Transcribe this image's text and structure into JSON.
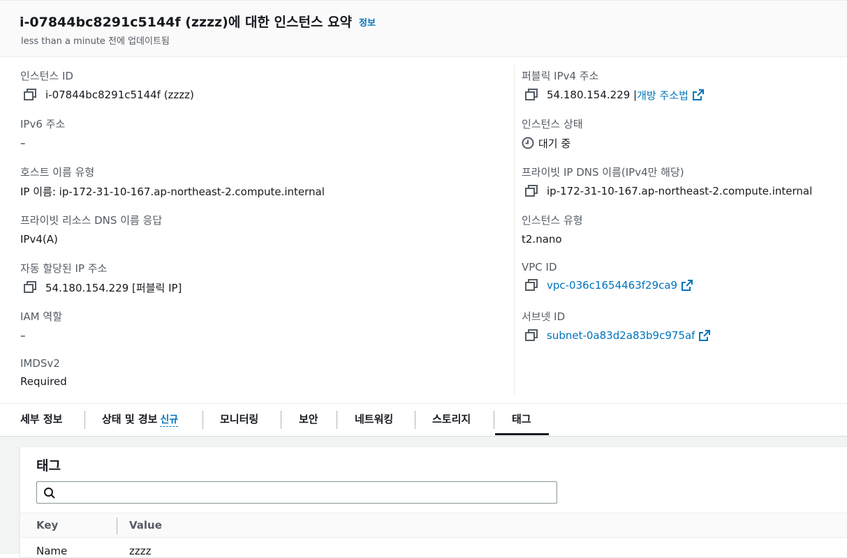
{
  "header": {
    "title": "i-07844bc8291c5144f (zzzz)에 대한 인스턴스 요약",
    "info_link": "정보",
    "updated": "less than a minute 전에 업데이트됨"
  },
  "left": {
    "instance_id": {
      "label": "인스턴스 ID",
      "value": "i-07844bc8291c5144f (zzzz)"
    },
    "ipv6": {
      "label": "IPv6 주소",
      "value": "–"
    },
    "hostname_type": {
      "label": "호스트 이름 유형",
      "value": "IP 이름: ip-172-31-10-167.ap-northeast-2.compute.internal"
    },
    "private_dns_answer": {
      "label": "프라이빗 리소스 DNS 이름 응답",
      "value": "IPv4(A)"
    },
    "auto_ip": {
      "label": "자동 할당된 IP 주소",
      "value": "54.180.154.229 [퍼블릭 IP]"
    },
    "iam_role": {
      "label": "IAM 역할",
      "value": "–"
    },
    "imdsv2": {
      "label": "IMDSv2",
      "value": "Required"
    }
  },
  "right": {
    "public_ipv4": {
      "label": "퍼블릭 IPv4 주소",
      "value": "54.180.154.229 |",
      "link": "개방 주소법"
    },
    "state": {
      "label": "인스턴스 상태",
      "value": "대기 중"
    },
    "private_dns": {
      "label": "프라이빗 IP DNS 이름(IPv4만 해당)",
      "value": "ip-172-31-10-167.ap-northeast-2.compute.internal"
    },
    "instance_type": {
      "label": "인스턴스 유형",
      "value": "t2.nano"
    },
    "vpc": {
      "label": "VPC ID",
      "value": "vpc-036c1654463f29ca9"
    },
    "subnet": {
      "label": "서브넷 ID",
      "value": "subnet-0a83d2a83b9c975af"
    }
  },
  "tabs": [
    {
      "label": "세부 정보"
    },
    {
      "label": "상태 및 경보",
      "badge": "신규"
    },
    {
      "label": "모니터링"
    },
    {
      "label": "보안"
    },
    {
      "label": "네트워킹"
    },
    {
      "label": "스토리지"
    },
    {
      "label": "태그",
      "active": true
    }
  ],
  "tags": {
    "title": "태그",
    "search": {
      "placeholder": "",
      "value": ""
    },
    "columns": [
      "Key",
      "Value"
    ],
    "rows": [
      {
        "key": "Name",
        "value": "zzzz"
      }
    ]
  },
  "colors": {
    "link": "#0073bb",
    "text": "#16191f",
    "label": "#545b64"
  }
}
